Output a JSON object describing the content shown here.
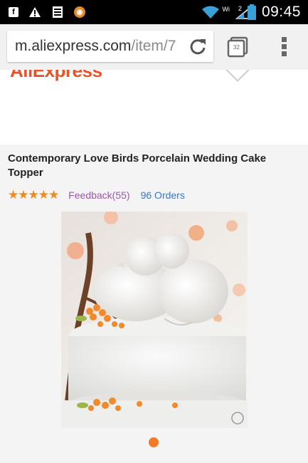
{
  "status_bar": {
    "time": "09:45",
    "network_label": "Wi",
    "sim_label": "2"
  },
  "browser": {
    "url_host": "m.aliexpress.com",
    "url_path": "/item/7",
    "tab_count": "32"
  },
  "page": {
    "logo_text": "AliExpress",
    "product_title": "Contemporary Love Birds Porcelain Wedding Cake Topper",
    "rating_stars": 5,
    "feedback_label": "Feedback(55)",
    "orders_label": "96 Orders",
    "gallery_page": 1,
    "gallery_total": 1
  },
  "colors": {
    "accent_orange": "#f07a2a",
    "feedback_purple": "#9b58a8",
    "orders_blue": "#3a78c2"
  }
}
